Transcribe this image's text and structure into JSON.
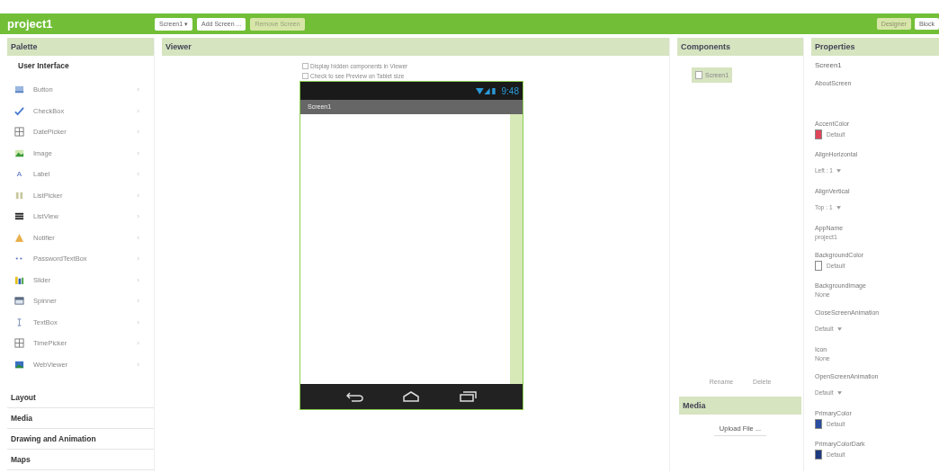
{
  "app": {
    "title": "project1"
  },
  "toolbar": [
    {
      "label": "Screen1 ▾",
      "disabled": false
    },
    {
      "label": "Add Screen ...",
      "disabled": false
    },
    {
      "label": "Remove Screen",
      "disabled": true
    }
  ],
  "view_switch": [
    {
      "label": "Designer",
      "selected": true
    },
    {
      "label": "Block",
      "selected": false
    }
  ],
  "palette": {
    "title": "Palette",
    "open_category": "User Interface",
    "items": [
      {
        "label": "Button"
      },
      {
        "label": "CheckBox"
      },
      {
        "label": "DatePicker"
      },
      {
        "label": "Image"
      },
      {
        "label": "Label",
        "glyph": "A"
      },
      {
        "label": "ListPicker"
      },
      {
        "label": "ListView"
      },
      {
        "label": "Notifier"
      },
      {
        "label": "PasswordTextBox"
      },
      {
        "label": "Slider"
      },
      {
        "label": "Spinner"
      },
      {
        "label": "TextBox"
      },
      {
        "label": "TimePicker"
      },
      {
        "label": "WebViewer"
      }
    ],
    "categories": [
      "Layout",
      "Media",
      "Drawing and Animation",
      "Maps"
    ]
  },
  "viewer": {
    "title": "Viewer",
    "options": [
      {
        "label": "Display hidden components in Viewer",
        "checked": false
      },
      {
        "label": "Check to see Preview on Tablet size",
        "checked": false
      }
    ],
    "phone": {
      "time": "9:48",
      "screen_title": "Screen1"
    }
  },
  "components": {
    "title": "Components",
    "tree": [
      {
        "label": "Screen1",
        "selected": true
      }
    ],
    "actions": [
      "Rename",
      "Delete"
    ]
  },
  "media": {
    "title": "Media",
    "upload": "Upload File ..."
  },
  "properties": {
    "title": "Properties",
    "component": "Screen1",
    "items": [
      {
        "kind": "textarea",
        "name": "AboutScreen"
      },
      {
        "kind": "color",
        "name": "AccentColor",
        "value": "Default",
        "color": "#e0455a"
      },
      {
        "kind": "dropdown",
        "name": "AlignHorizontal",
        "value": "Left : 1"
      },
      {
        "kind": "dropdown",
        "name": "AlignVertical",
        "value": "Top : 1"
      },
      {
        "kind": "text",
        "name": "AppName",
        "value": "project1"
      },
      {
        "kind": "color",
        "name": "BackgroundColor",
        "value": "Default",
        "color": "#ffffff"
      },
      {
        "kind": "text",
        "name": "BackgroundImage",
        "value": "None"
      },
      {
        "kind": "dropdown",
        "name": "CloseScreenAnimation",
        "value": "Default"
      },
      {
        "kind": "text",
        "name": "Icon",
        "value": "None"
      },
      {
        "kind": "dropdown",
        "name": "OpenScreenAnimation",
        "value": "Default"
      },
      {
        "kind": "color",
        "name": "PrimaryColor",
        "value": "Default",
        "color": "#2a4ea0"
      },
      {
        "kind": "color",
        "name": "PrimaryColorDark",
        "value": "Default",
        "color": "#1d3a80"
      }
    ]
  }
}
